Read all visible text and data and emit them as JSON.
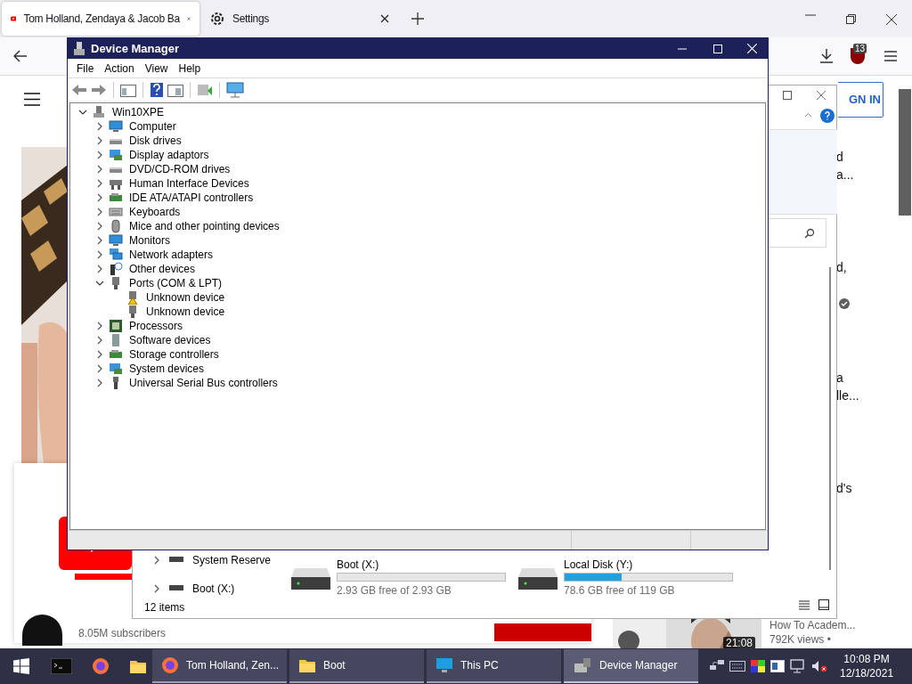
{
  "browser": {
    "tabs": [
      {
        "title": "Tom Holland, Zendaya & Jacob Ba",
        "kind": "video",
        "selected": true
      },
      {
        "title": "Settings",
        "kind": "settings",
        "selected": false
      }
    ],
    "extension_badge": "13"
  },
  "page": {
    "sign_in": "GN IN",
    "side_texts": [
      "d",
      "a...",
      "d,",
      "a",
      "lle...",
      "d's"
    ],
    "video_duration": "21:08",
    "video_channel": "How To Academ...",
    "video_views": "792K views •",
    "subscribers": "8.05M subscribers"
  },
  "explorer": {
    "nav_items": [
      "System Reserve",
      "Boot (X:)"
    ],
    "drives": [
      {
        "name": "Boot (X:)",
        "free": "2.93 GB free of 2.93 GB",
        "level": 0
      },
      {
        "name": "Local Disk (Y:)",
        "free": "78.6 GB free of 119 GB",
        "level": 0.34
      }
    ],
    "status": "12 items"
  },
  "device_manager": {
    "title": "Device Manager",
    "menu": [
      "File",
      "Action",
      "View",
      "Help"
    ],
    "tree": {
      "label": "Win10XPE",
      "kind": "pc",
      "expanded": true,
      "children": [
        {
          "label": "Computer",
          "kind": "monitor",
          "expanded": false
        },
        {
          "label": "Disk drives",
          "kind": "disk",
          "expanded": false
        },
        {
          "label": "Display adaptors",
          "kind": "display",
          "expanded": false
        },
        {
          "label": "DVD/CD-ROM drives",
          "kind": "disk",
          "expanded": false
        },
        {
          "label": "Human Interface Devices",
          "kind": "hid",
          "expanded": false
        },
        {
          "label": "IDE ATA/ATAPI controllers",
          "kind": "card",
          "expanded": false
        },
        {
          "label": "Keyboards",
          "kind": "keyboard",
          "expanded": false
        },
        {
          "label": "Mice and other pointing devices",
          "kind": "mouse",
          "expanded": false
        },
        {
          "label": "Monitors",
          "kind": "monitor",
          "expanded": false
        },
        {
          "label": "Network adapters",
          "kind": "network",
          "expanded": false
        },
        {
          "label": "Other devices",
          "kind": "other",
          "expanded": false
        },
        {
          "label": "Ports (COM & LPT)",
          "kind": "port",
          "expanded": true,
          "children": [
            {
              "label": "Unknown device",
              "kind": "port",
              "warning": true
            },
            {
              "label": "Unknown device",
              "kind": "port",
              "warning": false
            }
          ]
        },
        {
          "label": "Processors",
          "kind": "chip",
          "expanded": false
        },
        {
          "label": "Software devices",
          "kind": "software",
          "expanded": false
        },
        {
          "label": "Storage controllers",
          "kind": "card",
          "expanded": false
        },
        {
          "label": "System devices",
          "kind": "display",
          "expanded": false
        },
        {
          "label": "Universal Serial Bus controllers",
          "kind": "usb",
          "expanded": false
        }
      ]
    }
  },
  "taskbar": {
    "tasks": [
      {
        "label": "Tom Holland, Zen...",
        "kind": "firefox",
        "selected": false
      },
      {
        "label": "Boot",
        "kind": "folder",
        "selected": false
      },
      {
        "label": "This PC",
        "kind": "monitor",
        "selected": false
      },
      {
        "label": "Device Manager",
        "kind": "devmgr",
        "selected": true
      }
    ],
    "time": "10:08 PM",
    "date": "12/18/2021"
  }
}
